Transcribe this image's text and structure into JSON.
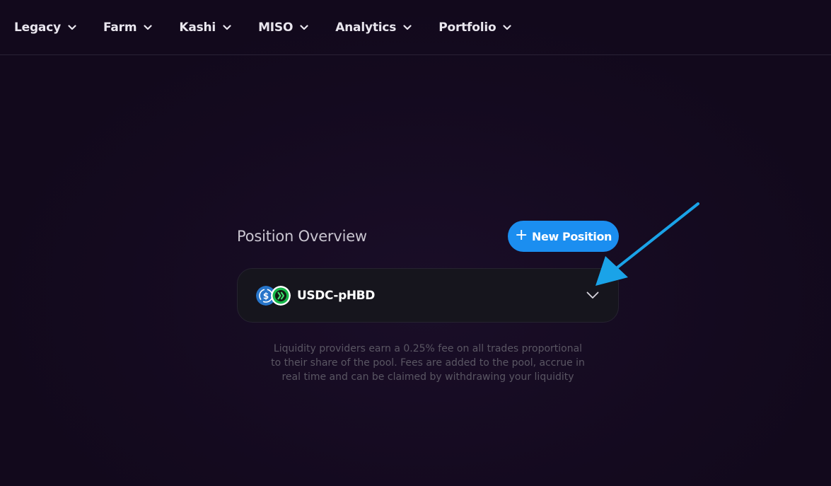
{
  "nav": {
    "items": [
      {
        "label": "Legacy"
      },
      {
        "label": "Farm"
      },
      {
        "label": "Kashi"
      },
      {
        "label": "MISO"
      },
      {
        "label": "Analytics"
      },
      {
        "label": "Portfolio"
      }
    ],
    "chevron_icon": "chevron-down-icon"
  },
  "main": {
    "title": "Position Overview",
    "new_position": {
      "plus": "+",
      "label": "New Position"
    },
    "position": {
      "pair": "USDC-pHBD",
      "token_icons": [
        "usdc-icon",
        "phbd-icon"
      ],
      "expand_icon": "chevron-down-icon"
    },
    "info_text": "Liquidity providers earn a 0.25% fee on all trades proportional to their share of the pool. Fees are added to the pool, accrue in real time and can be claimed by withdrawing your liquidity"
  },
  "colors": {
    "background": "#140a1f",
    "accent_blue": "#1b8ef0",
    "annotation_arrow": "#1aa3e8",
    "usdc_blue": "#2775ca",
    "phbd_green": "#16b84a"
  }
}
